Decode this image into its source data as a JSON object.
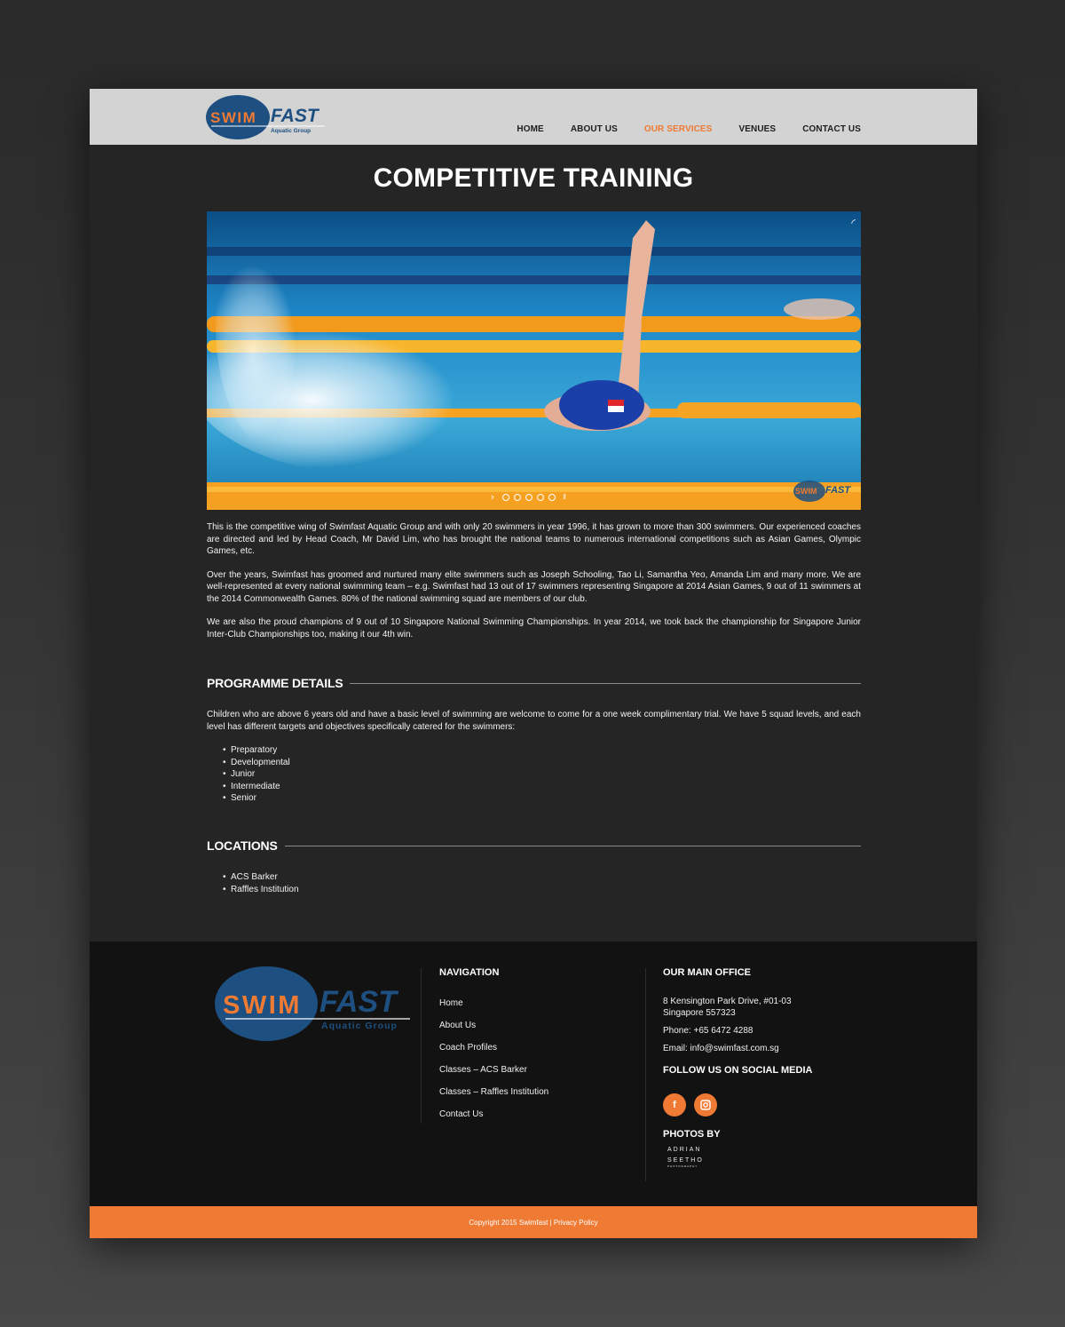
{
  "brand": {
    "logo_word1": "SWIM",
    "logo_word2": "FAST",
    "logo_tagline": "Aquatic Group",
    "accent_color": "#ef7a33",
    "navy_color": "#1d4f80"
  },
  "nav": {
    "items": [
      {
        "label": "HOME",
        "active": false
      },
      {
        "label": "ABOUT US",
        "active": false
      },
      {
        "label": "OUR SERVICES",
        "active": true
      },
      {
        "label": "VENUES",
        "active": false
      },
      {
        "label": "CONTACT US",
        "active": false
      }
    ]
  },
  "page": {
    "title": "COMPETITIVE TRAINING",
    "hero_image": "backstroke-swimmer-photo",
    "slider_dot_count": 5,
    "intro_paragraphs": [
      "This is the competitive wing of Swimfast Aquatic Group and with only 20 swimmers in year 1996, it has grown to more than 300 swimmers. Our experienced coaches are directed and led by Head Coach, Mr David Lim, who has brought the national teams to numerous international competitions such as Asian Games, Olympic Games, etc.",
      "Over the years, Swimfast has groomed and nurtured many elite swimmers such as Joseph Schooling, Tao Li, Samantha Yeo, Amanda Lim and many more. We are well-represented at every national swimming team – e.g. Swimfast had 13 out of 17 swimmers representing Singapore at 2014 Asian Games, 9 out of  11 swimmers at the 2014 Commonwealth Games. 80% of the national swimming squad are members of our club.",
      "We are also the proud champions of 9 out of 10 Singapore National Swimming Championships. In year 2014, we took back the championship for Singapore Junior Inter-Club Championships too, making it our 4th win."
    ]
  },
  "programme": {
    "heading": "PROGRAMME DETAILS",
    "text": "Children who are above 6 years old and have a basic level of swimming are welcome to come for a one week complimentary trial. We have 5 squad levels, and each level has different targets and objectives specifically catered for the swimmers:",
    "levels": [
      "Preparatory",
      "Developmental",
      "Junior",
      "Intermediate",
      "Senior"
    ]
  },
  "locations": {
    "heading": "LOCATIONS",
    "items": [
      "ACS Barker",
      "Raffles Institution"
    ]
  },
  "footer": {
    "nav_heading": "NAVIGATION",
    "nav_links": [
      "Home",
      "About Us",
      "Coach Profiles",
      "Classes – ACS Barker",
      "Classes – Raffles Institution",
      "Contact Us"
    ],
    "office_heading": "OUR MAIN OFFICE",
    "address_line1": "8 Kensington Park Drive, #01-03",
    "address_line2": "Singapore 557323",
    "phone": "Phone: +65 6472 4288",
    "email": "Email: info@swimfast.com.sg",
    "social_heading": "FOLLOW US ON SOCIAL MEDIA",
    "social_icons": [
      "facebook-icon",
      "instagram-icon"
    ],
    "photos_heading": "PHOTOS BY",
    "photographer_line1": "ADRIAN",
    "photographer_line2": "SEETHO",
    "photographer_line3": "PHOTOGRAPHY",
    "copyright": "Copyright 2015 Swimfast | Privacy Policy"
  }
}
